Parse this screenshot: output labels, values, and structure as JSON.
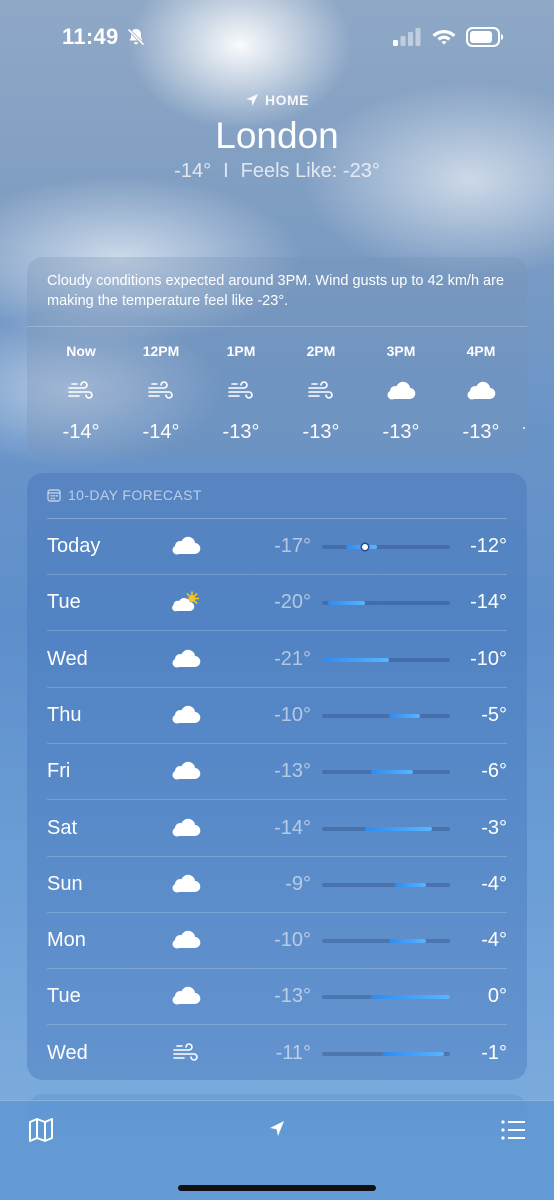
{
  "status_bar": {
    "time": "11:49"
  },
  "header": {
    "home_label": "HOME",
    "city": "London",
    "current_temp": "-14°",
    "separator": "I",
    "feels_like": "Feels Like: -23°"
  },
  "hourly": {
    "summary": "Cloudy conditions expected around 3PM. Wind gusts up to 42 km/h are making the temperature feel like -23°.",
    "hours": [
      {
        "label": "Now",
        "icon": "wind-icon",
        "temp": "-14°"
      },
      {
        "label": "12PM",
        "icon": "wind-icon",
        "temp": "-14°"
      },
      {
        "label": "1PM",
        "icon": "wind-icon",
        "temp": "-13°"
      },
      {
        "label": "2PM",
        "icon": "wind-icon",
        "temp": "-13°"
      },
      {
        "label": "3PM",
        "icon": "cloud-icon",
        "temp": "-13°"
      },
      {
        "label": "4PM",
        "icon": "cloud-icon",
        "temp": "-13°"
      }
    ]
  },
  "forecast": {
    "title": "10-DAY FORECAST",
    "range_min": -21,
    "range_max": 0,
    "days": [
      {
        "day": "Today",
        "icon": "cloud-icon",
        "low": "-17°",
        "high": "-12°",
        "low_val": -17,
        "high_val": -12,
        "current_val": -14
      },
      {
        "day": "Tue",
        "icon": "partly-sunny-icon",
        "low": "-20°",
        "high": "-14°",
        "low_val": -20,
        "high_val": -14
      },
      {
        "day": "Wed",
        "icon": "cloud-icon",
        "low": "-21°",
        "high": "-10°",
        "low_val": -21,
        "high_val": -10
      },
      {
        "day": "Thu",
        "icon": "cloud-icon",
        "low": "-10°",
        "high": "-5°",
        "low_val": -10,
        "high_val": -5
      },
      {
        "day": "Fri",
        "icon": "cloud-icon",
        "low": "-13°",
        "high": "-6°",
        "low_val": -13,
        "high_val": -6
      },
      {
        "day": "Sat",
        "icon": "cloud-icon",
        "low": "-14°",
        "high": "-3°",
        "low_val": -14,
        "high_val": -3
      },
      {
        "day": "Sun",
        "icon": "cloud-icon",
        "low": "-9°",
        "high": "-4°",
        "low_val": -9,
        "high_val": -4
      },
      {
        "day": "Mon",
        "icon": "cloud-icon",
        "low": "-10°",
        "high": "-4°",
        "low_val": -10,
        "high_val": -4
      },
      {
        "day": "Tue",
        "icon": "cloud-icon",
        "low": "-13°",
        "high": "0°",
        "low_val": -13,
        "high_val": 0
      },
      {
        "day": "Wed",
        "icon": "wind-icon",
        "low": "-11°",
        "high": "-1°",
        "low_val": -11,
        "high_val": -1
      }
    ]
  },
  "toolbar": {
    "map_icon": "map-icon",
    "location_icon": "location-arrow-icon",
    "list_icon": "list-icon"
  }
}
